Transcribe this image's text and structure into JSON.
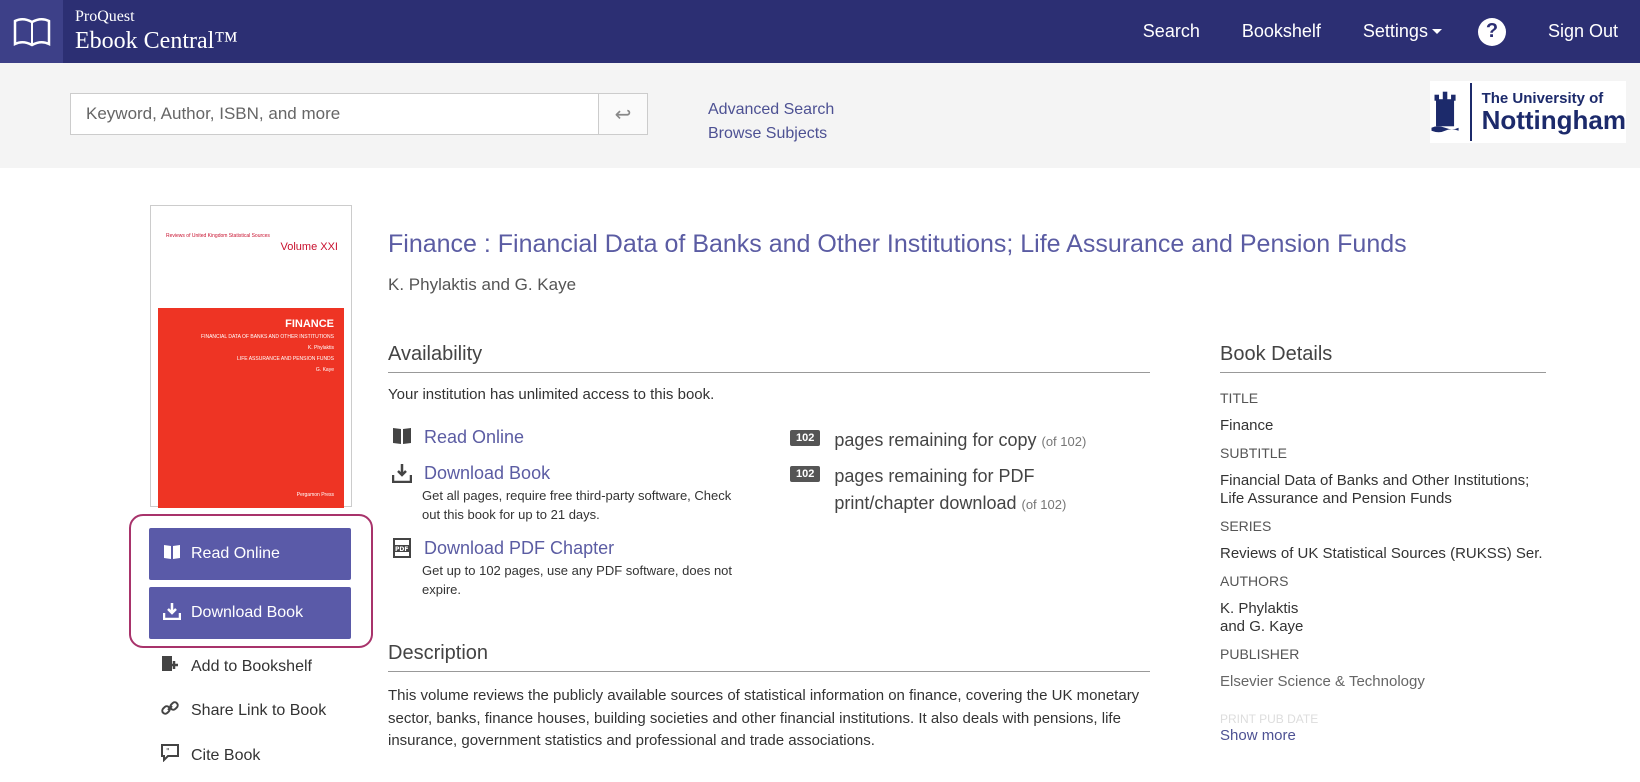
{
  "topbar": {
    "brand_small": "ProQuest",
    "brand_big": "Ebook Central™",
    "nav": [
      "Search",
      "Bookshelf",
      "Settings",
      "Sign Out"
    ],
    "help": "?"
  },
  "search": {
    "placeholder": "Keyword, Author, ISBN, and more",
    "submit_glyph": "↩",
    "links": [
      "Advanced Search",
      "Browse Subjects"
    ]
  },
  "university": {
    "line1": "The University of",
    "line2": "Nottingham"
  },
  "cover": {
    "series_hdr": "Reviews of United Kingdom Statistical Sources",
    "volume": "Volume XXI",
    "heading": "FINANCE",
    "subtitle": "FINANCIAL DATA OF BANKS AND OTHER INSTITUTIONS",
    "author1": "K. Phylaktis",
    "subtitle2": "LIFE ASSURANCE AND PENSION FUNDS",
    "author2": "G. Kaye",
    "footer": "Pergamon Press"
  },
  "actions": {
    "read_online": "Read Online",
    "download_book": "Download Book",
    "add_bookshelf": "Add to Bookshelf",
    "share_link": "Share Link to Book",
    "cite_book": "Cite Book"
  },
  "book": {
    "title": "Finance : Financial Data of Banks and Other Institutions; Life Assurance and Pension Funds",
    "authors": "K. Phylaktis and G. Kaye"
  },
  "availability": {
    "heading": "Availability",
    "access": "Your institution has unlimited access to this book.",
    "options": [
      {
        "label": "Read Online",
        "desc": ""
      },
      {
        "label": "Download Book",
        "desc": "Get all pages, require free third-party software, Check out this book for up to 21 days."
      },
      {
        "label": "Download PDF Chapter",
        "desc": "Get up to 102 pages, use any PDF software, does not expire."
      }
    ],
    "counters": [
      {
        "count": "102",
        "text": "pages remaining for copy",
        "of": "(of 102)"
      },
      {
        "count": "102",
        "text": "pages remaining for PDF print/chapter download",
        "of": "(of 102)"
      }
    ]
  },
  "description": {
    "heading": "Description",
    "text": "This volume reviews the publicly available sources of statistical information on finance, covering the UK monetary sector, banks, finance houses, building societies and other financial institutions. It also deals with pensions, life insurance, government statistics and professional and trade associations."
  },
  "details": {
    "heading": "Book Details",
    "items": [
      {
        "label": "TITLE",
        "value": "Finance"
      },
      {
        "label": "SUBTITLE",
        "value": "Financial Data of Banks and Other Institutions; Life Assurance and Pension Funds"
      },
      {
        "label": "SERIES",
        "value": "Reviews of UK Statistical Sources (RUKSS) Ser."
      },
      {
        "label": "AUTHORS",
        "value": "K. Phylaktis and G. Kaye"
      },
      {
        "label": "PUBLISHER",
        "value": "Elsevier Science & Technology"
      }
    ],
    "faded_label": "PRINT PUB DATE",
    "show_more": "Show more"
  }
}
